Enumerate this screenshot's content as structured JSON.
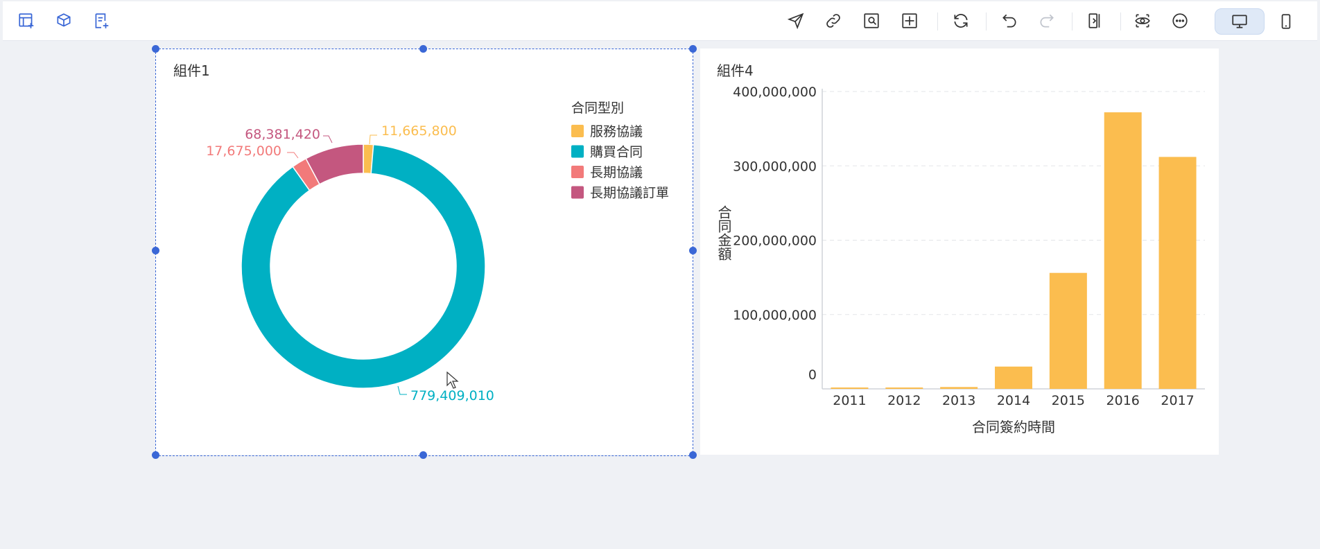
{
  "toolbar": {
    "left_icons": [
      "add-chart-icon",
      "add-cube-icon",
      "add-list-icon"
    ],
    "right_icons": [
      "send-icon",
      "link-icon",
      "image-search-icon",
      "grid-icon",
      "refresh-icon",
      "undo-icon",
      "redo-icon",
      "export-icon",
      "preview-icon",
      "more-icon"
    ],
    "view_modes": [
      "desktop-icon",
      "mobile-icon"
    ],
    "accent_color": "#3a67d6"
  },
  "widget1": {
    "title": "組件1",
    "chart_data": {
      "type": "pie",
      "legend_title": "合同型別",
      "legend_position": "top-right",
      "slices": [
        {
          "name": "服務協議",
          "value": 11665800,
          "label": "11,665,800",
          "color": "#fbbd4f"
        },
        {
          "name": "購買合同",
          "value": 779409010,
          "label": "779,409,010",
          "color": "#00b0c3"
        },
        {
          "name": "長期協議",
          "value": 17675000,
          "label": "17,675,000",
          "color": "#f27a7a"
        },
        {
          "name": "長期協議訂單",
          "value": 68381420,
          "label": "68,381,420",
          "color": "#c4577f"
        }
      ]
    }
  },
  "widget4": {
    "title": "組件4",
    "chart_data": {
      "type": "bar",
      "categories": [
        "2011",
        "2012",
        "2013",
        "2014",
        "2015",
        "2016",
        "2017"
      ],
      "values": [
        700000,
        900000,
        2500000,
        30000000,
        156000000,
        372000000,
        312000000
      ],
      "xlabel": "合同簽約時間",
      "ylabel": "合同金額",
      "ylim": [
        0,
        400000000
      ],
      "yticks": [
        {
          "value": 0,
          "label": "0"
        },
        {
          "value": 100000000,
          "label": "100,000,000"
        },
        {
          "value": 200000000,
          "label": "200,000,000"
        },
        {
          "value": 300000000,
          "label": "300,000,000"
        },
        {
          "value": 400000000,
          "label": "400,000,000"
        }
      ],
      "grid": true,
      "bar_color": "#fbbd4f"
    }
  }
}
